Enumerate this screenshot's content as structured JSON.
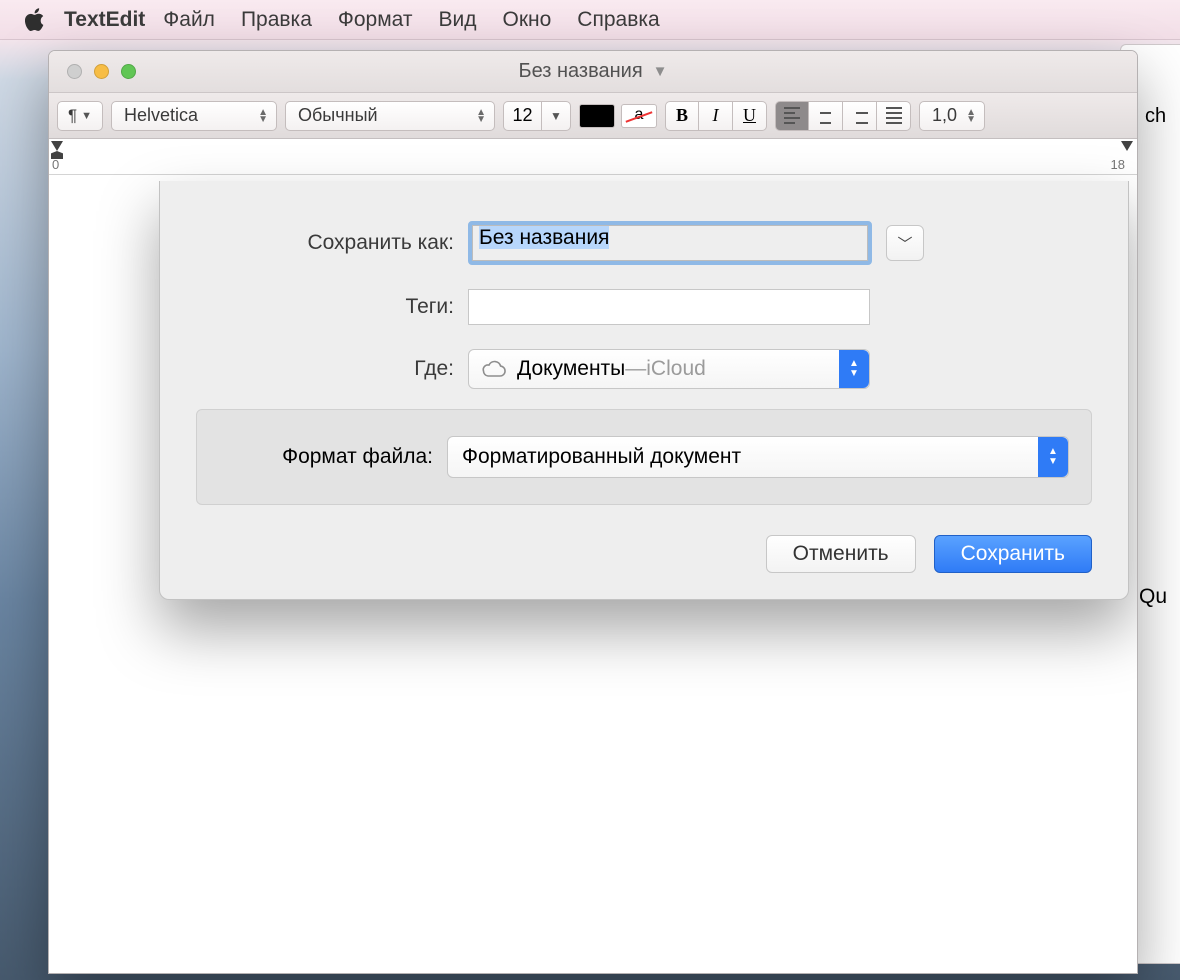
{
  "menubar": {
    "app": "TextEdit",
    "items": [
      "Файл",
      "Правка",
      "Формат",
      "Вид",
      "Окно",
      "Справка"
    ]
  },
  "window": {
    "title": "Без названия"
  },
  "toolbar": {
    "para_button": "¶",
    "font": "Helvetica",
    "style": "Обычный",
    "size": "12",
    "bold": "B",
    "italic": "I",
    "underline": "U",
    "strike_char": "a",
    "line_spacing": "1,0"
  },
  "ruler": {
    "start": "0",
    "end": "18"
  },
  "save_dialog": {
    "save_as_label": "Сохранить как:",
    "filename": "Без названия",
    "tags_label": "Теги:",
    "tags_value": "",
    "where_label": "Где:",
    "where_folder": "Документы",
    "where_dash": " — ",
    "where_service": "iCloud",
    "format_label": "Формат файла:",
    "format_value": "Форматированный документ",
    "cancel": "Отменить",
    "save": "Сохранить"
  },
  "background_fragments": {
    "top": "ch",
    "mid": "Qu"
  }
}
